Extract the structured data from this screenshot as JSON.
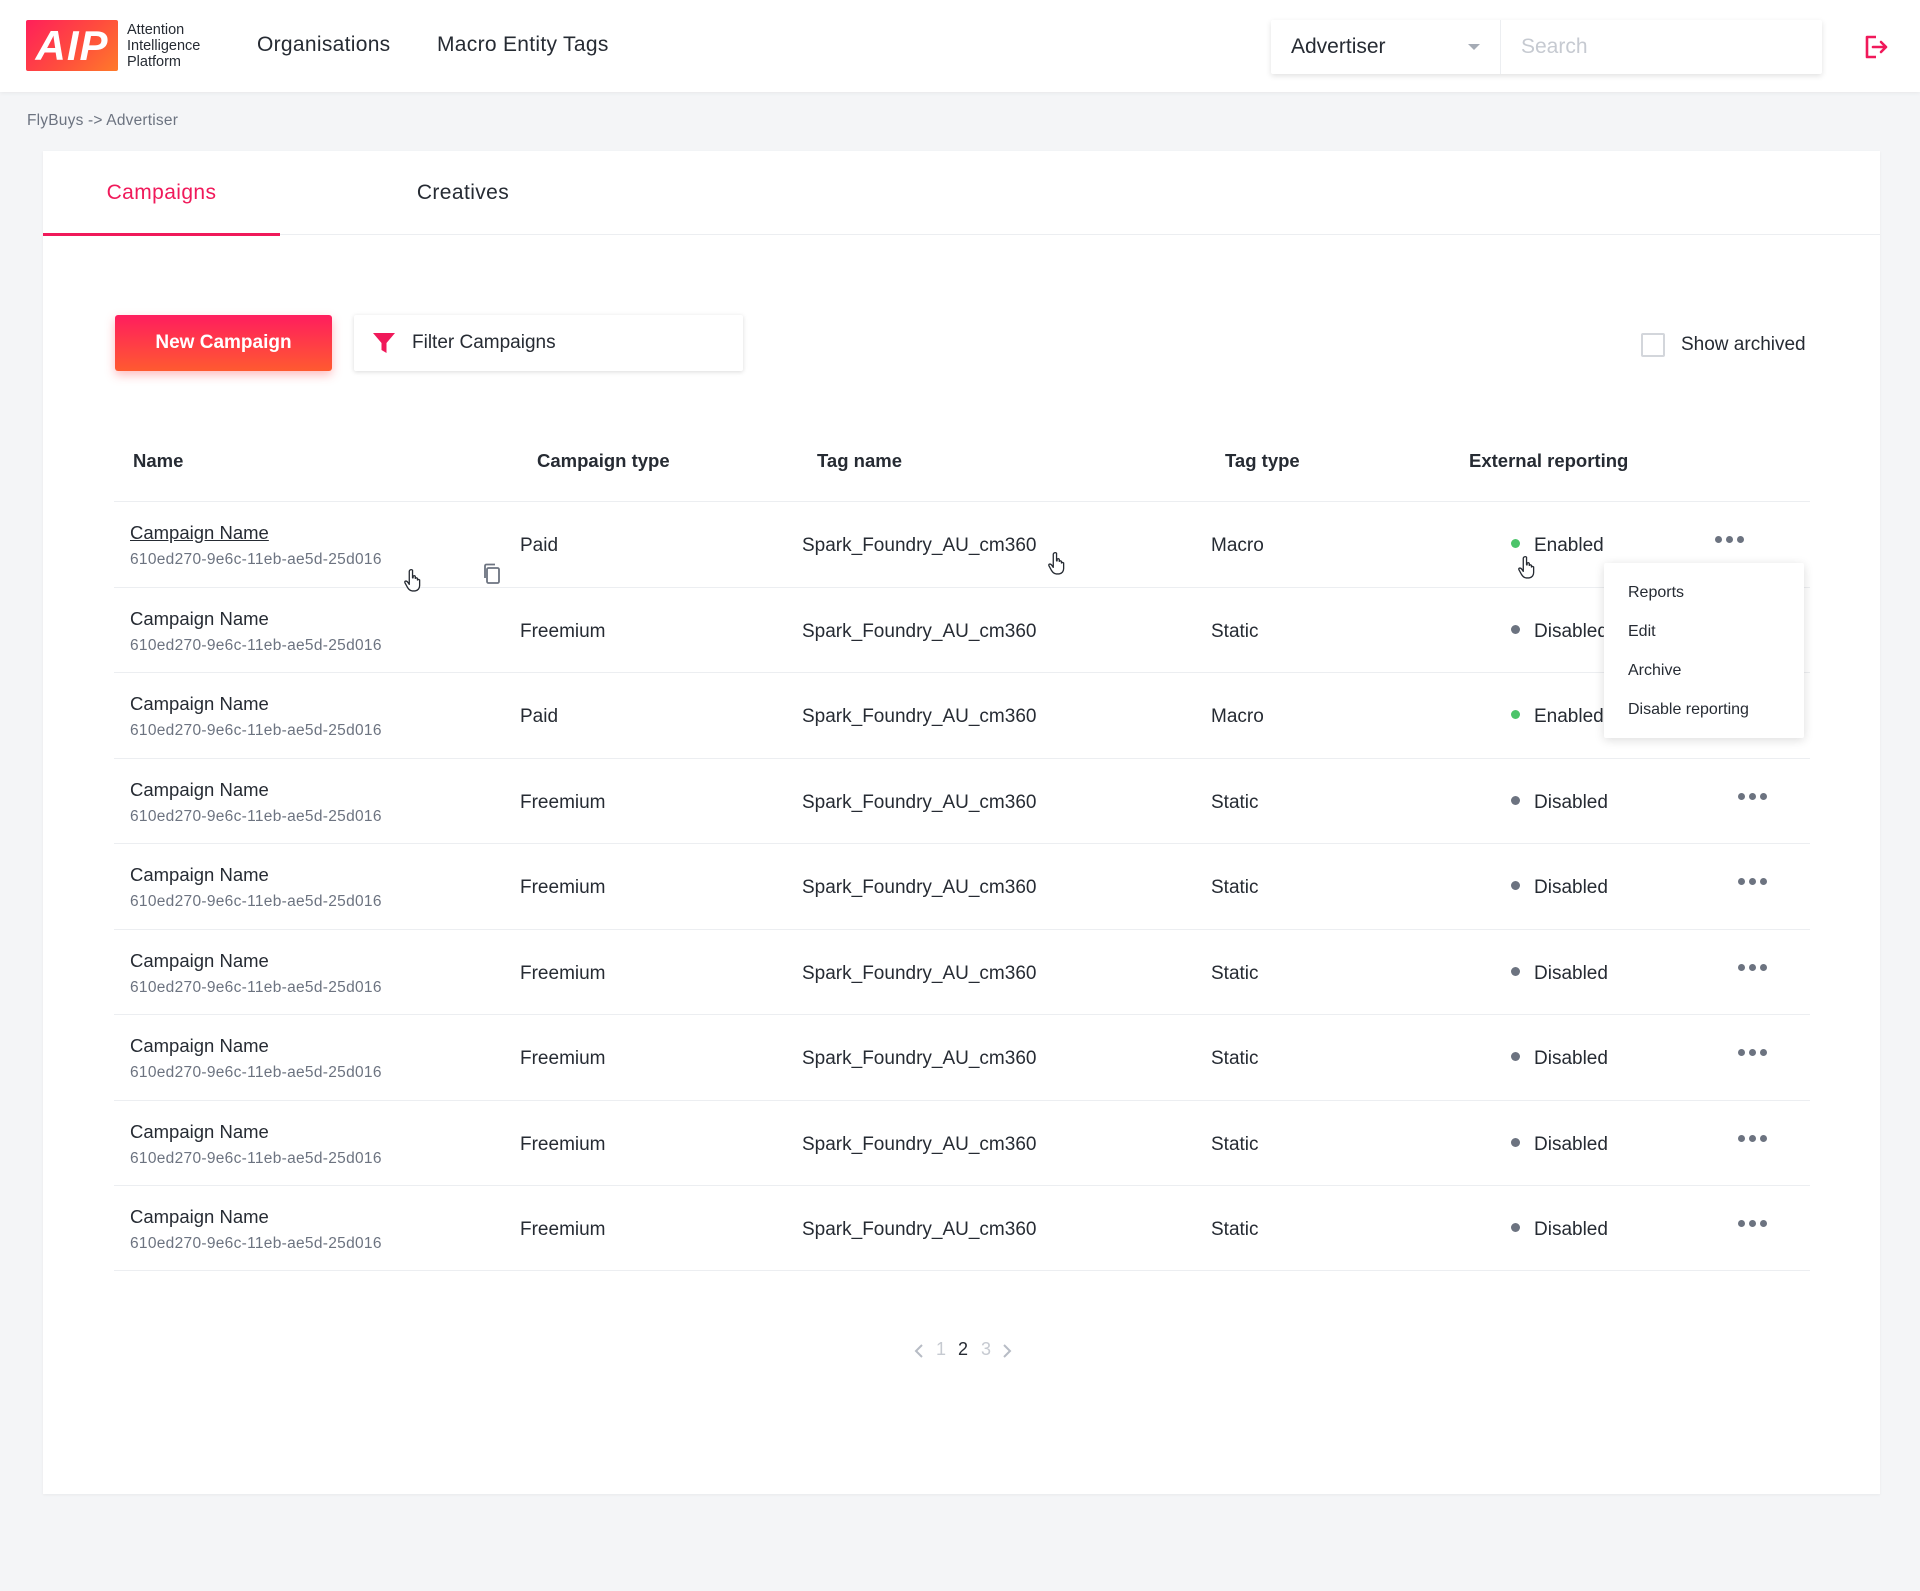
{
  "header": {
    "logo_mark": "AIP",
    "logo_text": "Attention Intelligence Platform",
    "nav": [
      "Organisations",
      "Macro Entity Tags"
    ],
    "select_value": "Advertiser",
    "search_placeholder": "Search",
    "accent_color": "#f0195a"
  },
  "breadcrumb": "FlyBuys -> Advertiser",
  "tabs": [
    {
      "label": "Campaigns",
      "active": true
    },
    {
      "label": "Creatives",
      "active": false
    }
  ],
  "toolbar": {
    "new_campaign": "New Campaign",
    "filter_campaigns": "Filter Campaigns",
    "show_archived": "Show archived"
  },
  "table": {
    "columns": [
      "Name",
      "Campaign type",
      "Tag name",
      "Tag type",
      "External reporting"
    ],
    "rows": [
      {
        "name": "Campaign Name",
        "id": "610ed270-9e6c-11eb-ae5d-25d016",
        "type": "Paid",
        "tag_name": "Spark_Foundry_AU_cm360",
        "tag_type": "Macro",
        "reporting": "Enabled"
      },
      {
        "name": "Campaign Name",
        "id": "610ed270-9e6c-11eb-ae5d-25d016",
        "type": "Freemium",
        "tag_name": "Spark_Foundry_AU_cm360",
        "tag_type": "Static",
        "reporting": "Disabled"
      },
      {
        "name": "Campaign Name",
        "id": "610ed270-9e6c-11eb-ae5d-25d016",
        "type": "Paid",
        "tag_name": "Spark_Foundry_AU_cm360",
        "tag_type": "Macro",
        "reporting": "Enabled"
      },
      {
        "name": "Campaign Name",
        "id": "610ed270-9e6c-11eb-ae5d-25d016",
        "type": "Freemium",
        "tag_name": "Spark_Foundry_AU_cm360",
        "tag_type": "Static",
        "reporting": "Disabled"
      },
      {
        "name": "Campaign Name",
        "id": "610ed270-9e6c-11eb-ae5d-25d016",
        "type": "Freemium",
        "tag_name": "Spark_Foundry_AU_cm360",
        "tag_type": "Static",
        "reporting": "Disabled"
      },
      {
        "name": "Campaign Name",
        "id": "610ed270-9e6c-11eb-ae5d-25d016",
        "type": "Freemium",
        "tag_name": "Spark_Foundry_AU_cm360",
        "tag_type": "Static",
        "reporting": "Disabled"
      },
      {
        "name": "Campaign Name",
        "id": "610ed270-9e6c-11eb-ae5d-25d016",
        "type": "Freemium",
        "tag_name": "Spark_Foundry_AU_cm360",
        "tag_type": "Static",
        "reporting": "Disabled"
      },
      {
        "name": "Campaign Name",
        "id": "610ed270-9e6c-11eb-ae5d-25d016",
        "type": "Freemium",
        "tag_name": "Spark_Foundry_AU_cm360",
        "tag_type": "Static",
        "reporting": "Disabled"
      },
      {
        "name": "Campaign Name",
        "id": "610ed270-9e6c-11eb-ae5d-25d016",
        "type": "Freemium",
        "tag_name": "Spark_Foundry_AU_cm360",
        "tag_type": "Static",
        "reporting": "Disabled"
      }
    ]
  },
  "row_menu": [
    "Reports",
    "Edit",
    "Archive",
    "Disable reporting"
  ],
  "status_colors": {
    "Enabled": "#4cc46a",
    "Disabled": "#6c7380"
  },
  "pagination": {
    "pages": [
      "1",
      "2",
      "3"
    ],
    "current": "2"
  }
}
